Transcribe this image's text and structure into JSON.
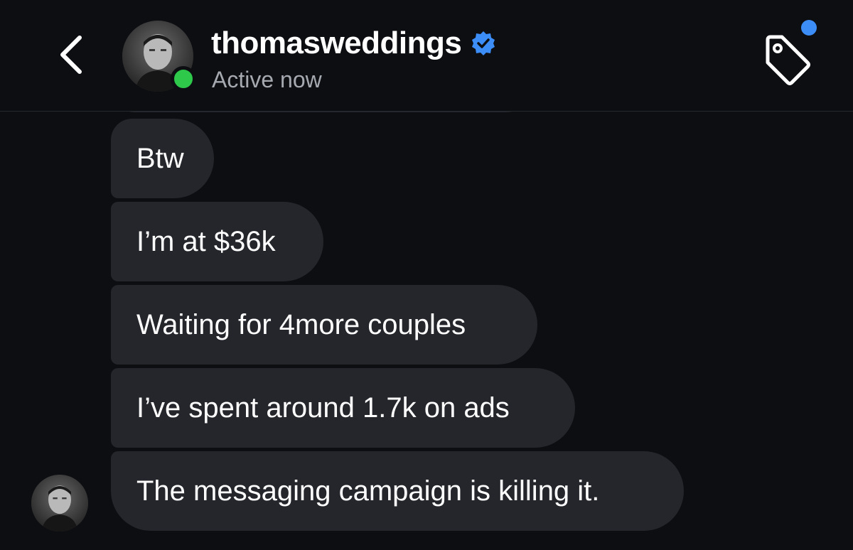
{
  "header": {
    "username": "thomasweddings",
    "status": "Active now",
    "icons": {
      "back": "chevron-left-icon",
      "verified": "verified-badge-icon",
      "tag": "tag-icon",
      "notification": "notification-dot"
    }
  },
  "messages": [
    {
      "text": "Btw"
    },
    {
      "text": "I’m at $36k"
    },
    {
      "text": "Waiting for 4more couples"
    },
    {
      "text": "I’ve spent around 1.7k on ads"
    },
    {
      "text": "The messaging campaign is killing it."
    }
  ],
  "colors": {
    "background": "#0c0e12",
    "bubble": "#24262b",
    "online": "#2ec84b",
    "verified": "#3d8df7",
    "status_text": "#a6a9b0"
  }
}
